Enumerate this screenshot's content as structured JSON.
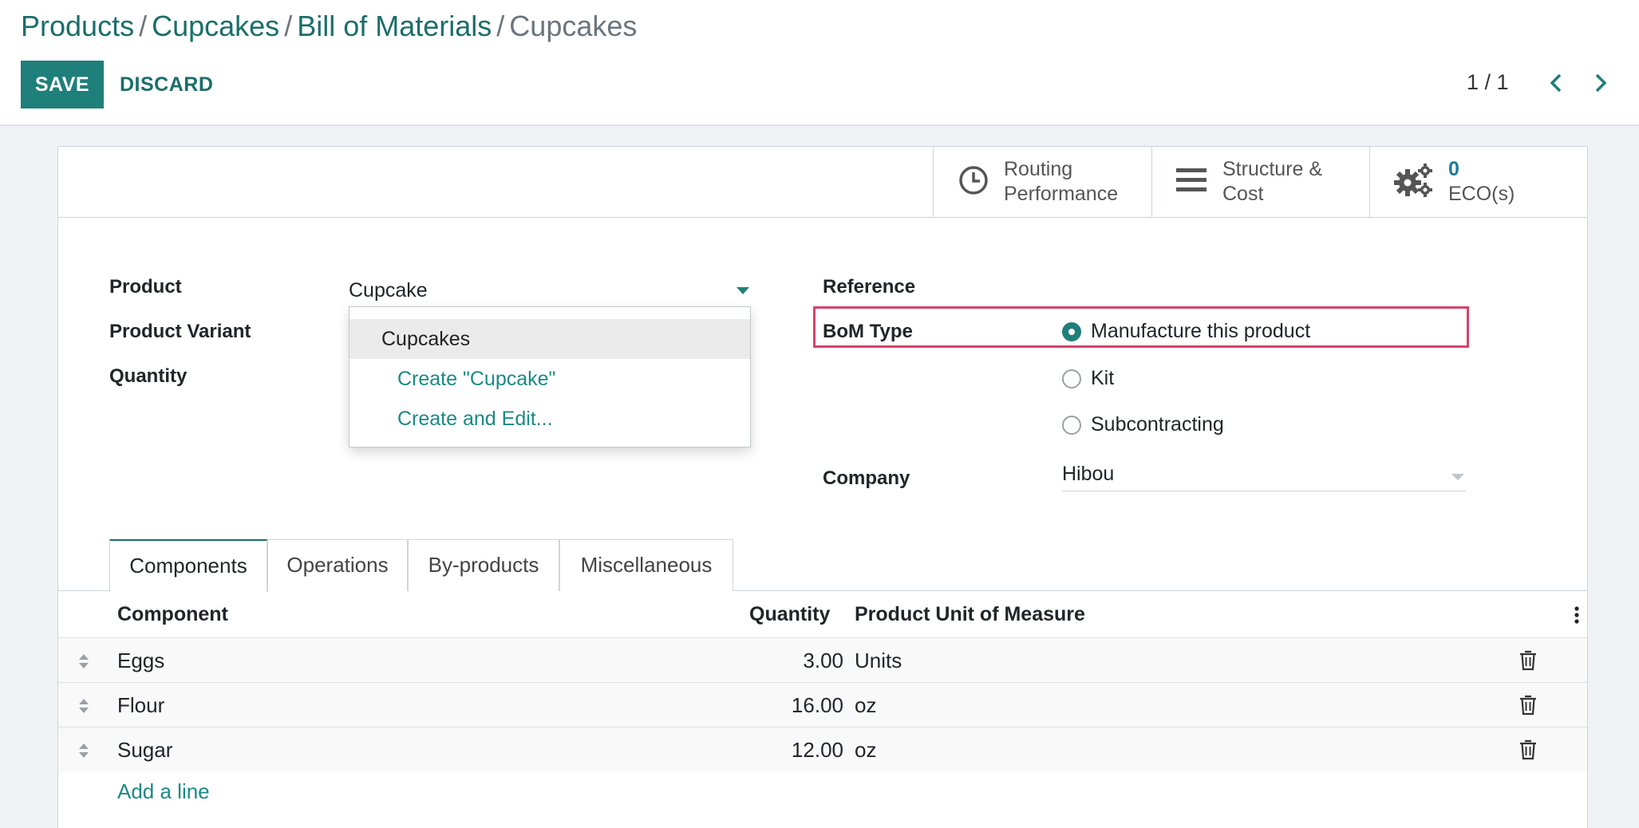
{
  "breadcrumb": {
    "items": [
      "Products",
      "Cupcakes",
      "Bill of Materials"
    ],
    "separator": "/",
    "current": "Cupcakes"
  },
  "toolbar": {
    "save_label": "SAVE",
    "discard_label": "DISCARD",
    "pager": "1 / 1",
    "prev_icon": "chevron-left-icon",
    "next_icon": "chevron-right-icon"
  },
  "stat_buttons": [
    {
      "icon": "clock-icon",
      "line1": "Routing",
      "line2": "Performance"
    },
    {
      "icon": "bars-icon",
      "line1": "Structure &",
      "line2": "Cost"
    },
    {
      "icon": "gears-icon",
      "line1": "0",
      "line2": "ECO(s)"
    }
  ],
  "form": {
    "product_label": "Product",
    "product_value": "Cupcake",
    "product_variant_label": "Product Variant",
    "quantity_label": "Quantity",
    "reference_label": "Reference",
    "bom_type_label": "BoM Type",
    "bom_type_options": [
      "Manufacture this product",
      "Kit",
      "Subcontracting"
    ],
    "bom_type_selected": "Manufacture this product",
    "company_label": "Company",
    "company_value": "Hibou"
  },
  "autocomplete": {
    "items": [
      "Cupcakes",
      "Create \"Cupcake\"",
      "Create and Edit..."
    ]
  },
  "tabs": [
    "Components",
    "Operations",
    "By-products",
    "Miscellaneous"
  ],
  "active_tab": "Components",
  "table": {
    "headers": {
      "component": "Component",
      "quantity": "Quantity",
      "uom": "Product Unit of Measure"
    },
    "rows": [
      {
        "component": "Eggs",
        "quantity": "3.00",
        "uom": "Units"
      },
      {
        "component": "Flour",
        "quantity": "16.00",
        "uom": "oz"
      },
      {
        "component": "Sugar",
        "quantity": "12.00",
        "uom": "oz"
      }
    ],
    "add_line": "Add a line"
  },
  "colors": {
    "primary": "#1f7f7a",
    "link": "#1a6e6a",
    "highlight": "#d6426b",
    "stat_number": "#1a7b9c"
  }
}
